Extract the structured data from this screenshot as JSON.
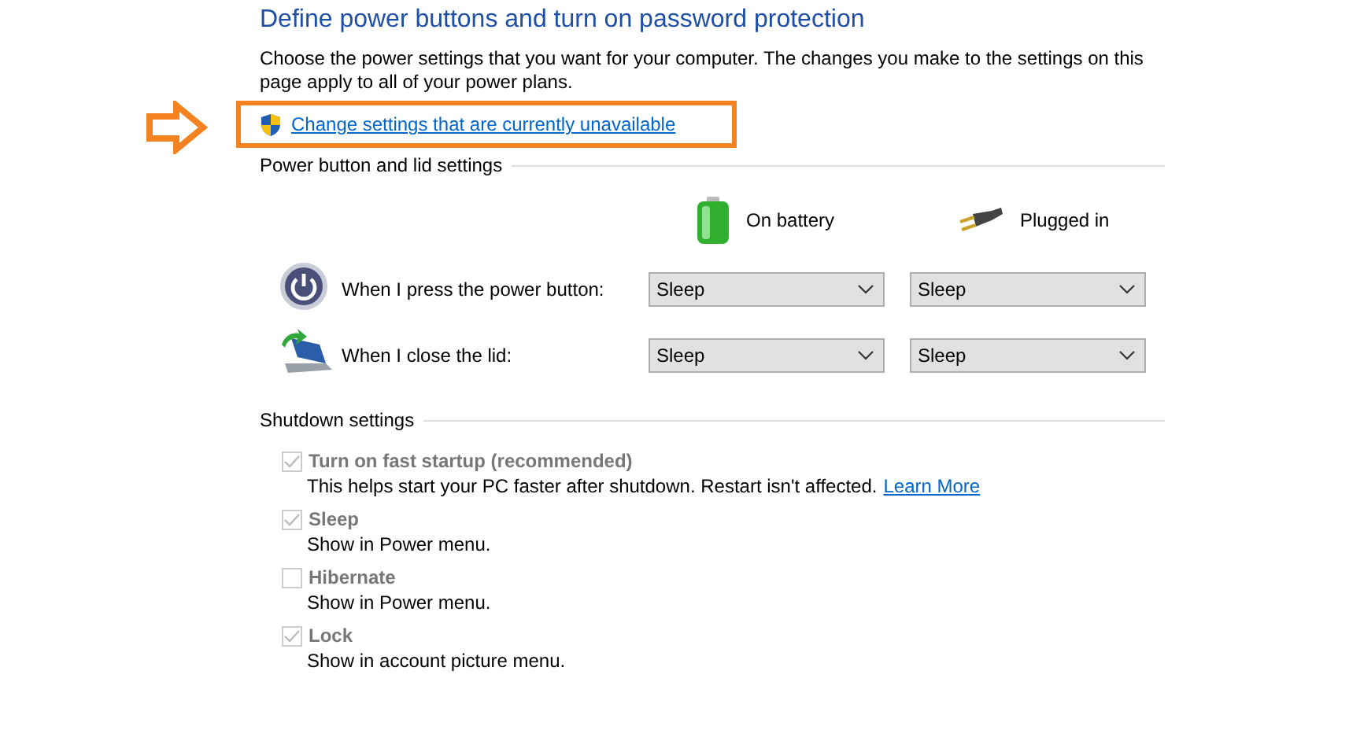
{
  "title": "Define power buttons and turn on password protection",
  "intro": "Choose the power settings that you want for your computer. The changes you make to the settings on this page apply to all of your power plans.",
  "admin_link": "Change settings that are currently unavailable",
  "power_section": {
    "heading": "Power button and lid settings",
    "columns": [
      {
        "kind": "battery",
        "label": "On battery"
      },
      {
        "kind": "plug",
        "label": "Plugged in"
      }
    ],
    "rows": [
      {
        "kind": "power",
        "label": "When I press the power button:",
        "values": [
          "Sleep",
          "Sleep"
        ]
      },
      {
        "kind": "lid",
        "label": "When I close the lid:",
        "values": [
          "Sleep",
          "Sleep"
        ]
      }
    ]
  },
  "shutdown_section": {
    "heading": "Shutdown settings",
    "options": [
      {
        "label": "Turn on fast startup (recommended)",
        "checked": true,
        "disabled": true,
        "description": "This helps start your PC faster after shutdown. Restart isn't affected.",
        "link": "Learn More"
      },
      {
        "label": "Sleep",
        "checked": true,
        "disabled": true,
        "description": "Show in Power menu."
      },
      {
        "label": "Hibernate",
        "checked": false,
        "disabled": true,
        "description": "Show in Power menu."
      },
      {
        "label": "Lock",
        "checked": true,
        "disabled": true,
        "description": "Show in account picture menu."
      }
    ]
  }
}
